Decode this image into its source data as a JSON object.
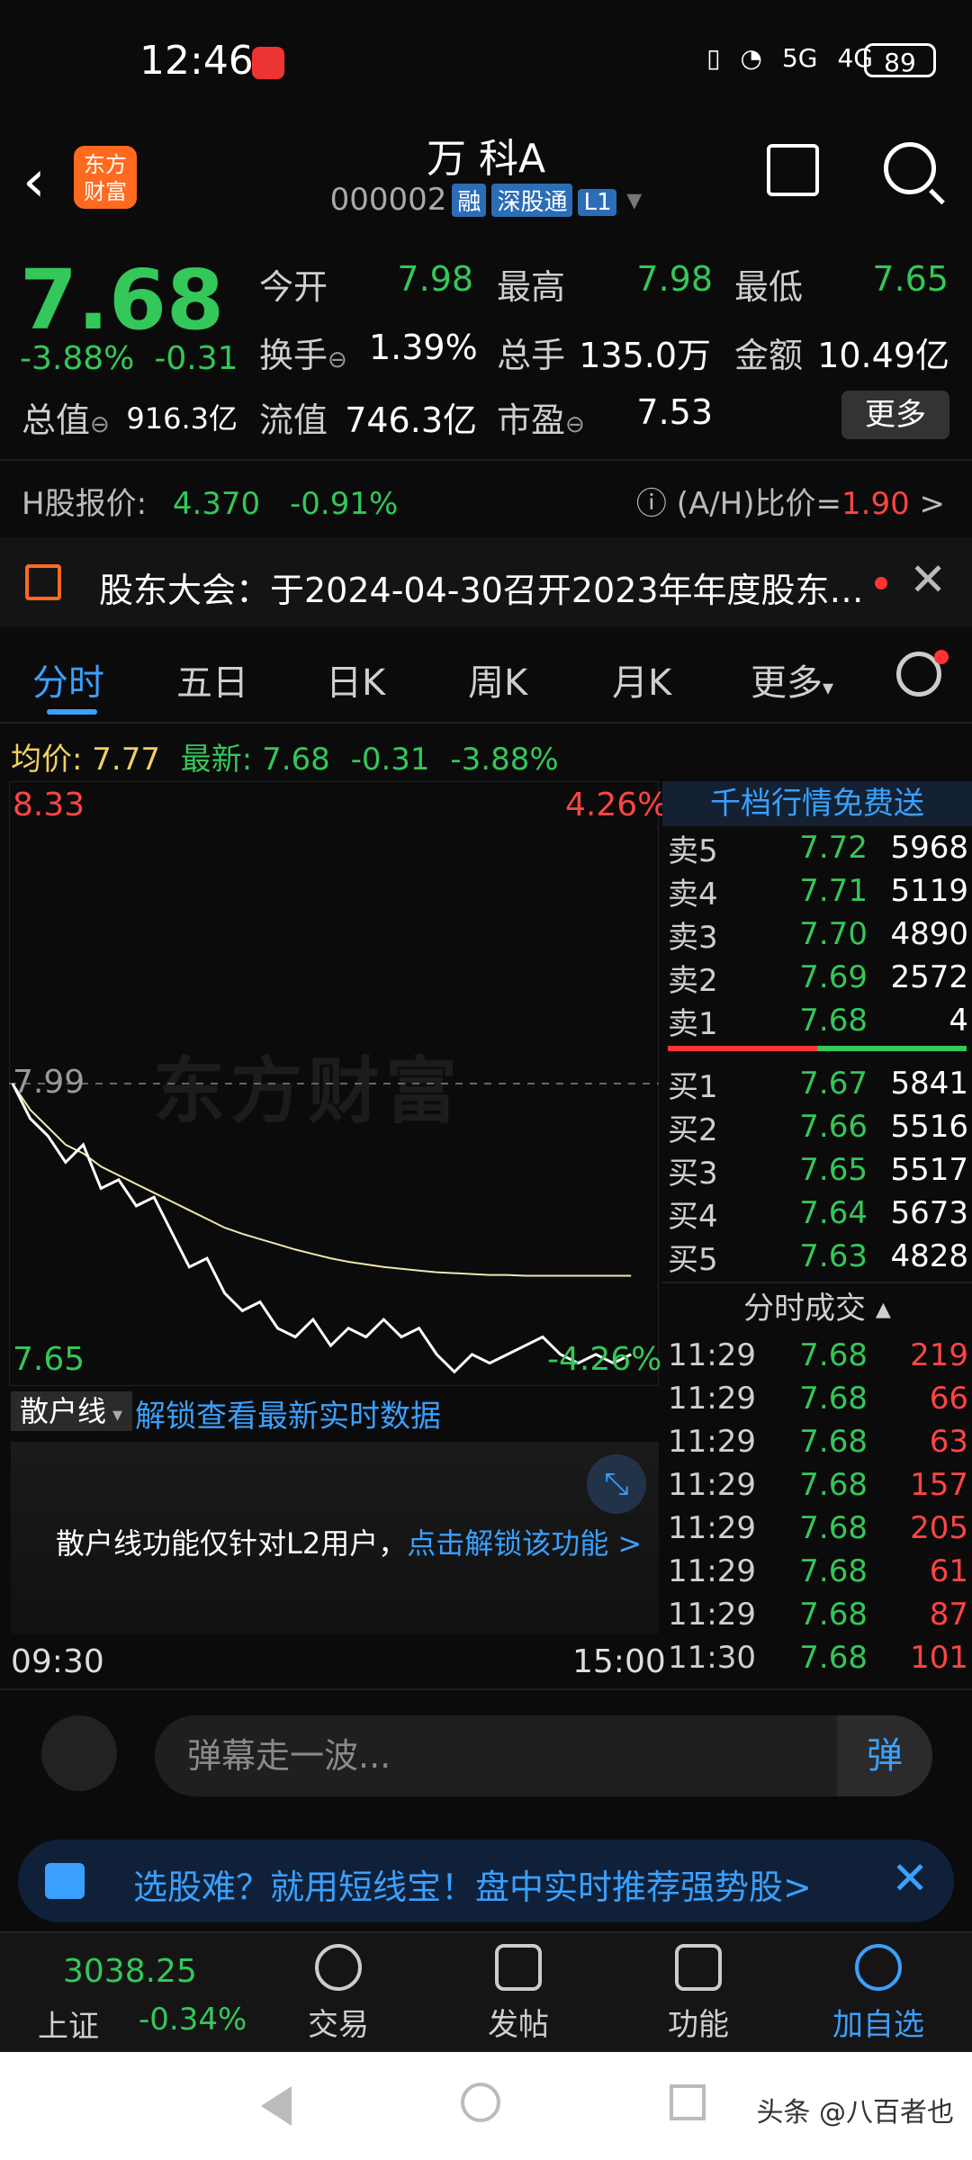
{
  "status": {
    "time": "12:46",
    "network": "5G",
    "network2": "4G",
    "battery": "89"
  },
  "header": {
    "name": "万 科A",
    "code": "000002",
    "tags": [
      "融",
      "深股通",
      "L1"
    ],
    "logo": "东方\n财富"
  },
  "quote": {
    "price": "7.68",
    "pct": "-3.88%",
    "chg": "-0.31",
    "open_lbl": "今开",
    "open": "7.98",
    "high_lbl": "最高",
    "high": "7.98",
    "low_lbl": "最低",
    "low": "7.65",
    "turnover_lbl": "换手",
    "turnover": "1.39%",
    "vol_lbl": "总手",
    "vol": "135.0万",
    "amt_lbl": "金额",
    "amt": "10.49亿",
    "mcap_lbl": "总值",
    "mcap": "916.3亿",
    "float_lbl": "流值",
    "float": "746.3亿",
    "pe_lbl": "市盈",
    "pe": "7.53",
    "more": "更多"
  },
  "hshare": {
    "label": "H股报价:",
    "price": "4.370",
    "pct": "-0.91%",
    "ah_lbl": "(A/H)比价=",
    "ah": "1.90"
  },
  "notice": {
    "text": "股东大会：于2024-04-30召开2023年年度股东…"
  },
  "tabs": [
    "分时",
    "五日",
    "日K",
    "周K",
    "月K",
    "更多"
  ],
  "avg": {
    "lbl": "均价:",
    "val": "7.77",
    "new_lbl": "最新:",
    "new": "7.68",
    "chg": "-0.31",
    "pct": "-3.88%"
  },
  "chart_data": {
    "type": "line",
    "title": "",
    "y_max": "8.33",
    "y_mid": "7.99",
    "y_min": "7.65",
    "pct_max": "4.26%",
    "pct_min": "-4.26%",
    "x_start": "09:30",
    "x_end": "15:00",
    "ylim": [
      7.65,
      8.33
    ],
    "series": [
      {
        "values": [
          7.99,
          7.95,
          7.93,
          7.9,
          7.92,
          7.87,
          7.88,
          7.85,
          7.86,
          7.82,
          7.78,
          7.79,
          7.75,
          7.73,
          7.74,
          7.71,
          7.7,
          7.72,
          7.69,
          7.71,
          7.7,
          7.72,
          7.7,
          7.71,
          7.68,
          7.66,
          7.68,
          7.67,
          7.68,
          7.69,
          7.7,
          7.68,
          7.67,
          7.68,
          7.67,
          7.68
        ]
      },
      {
        "values": [
          7.99,
          7.96,
          7.94,
          7.92,
          7.91,
          7.895,
          7.885,
          7.875,
          7.865,
          7.855,
          7.845,
          7.835,
          7.825,
          7.818,
          7.812,
          7.806,
          7.8,
          7.795,
          7.79,
          7.786,
          7.783,
          7.78,
          7.778,
          7.776,
          7.774,
          7.773,
          7.772,
          7.771,
          7.771,
          7.77,
          7.77,
          7.77,
          7.77,
          7.77,
          7.77,
          7.77
        ]
      }
    ]
  },
  "watermark": "东方财富",
  "sanhu": {
    "tag": "散户线",
    "link": "解锁查看最新实时数据",
    "msg": "散户线功能仅针对L2用户，",
    "unlock": "点击解锁该功能 >"
  },
  "orderbook": {
    "head": "千档行情免费送",
    "sells": [
      [
        "卖5",
        "7.72",
        "5968"
      ],
      [
        "卖4",
        "7.71",
        "5119"
      ],
      [
        "卖3",
        "7.70",
        "4890"
      ],
      [
        "卖2",
        "7.69",
        "2572"
      ],
      [
        "卖1",
        "7.68",
        "4"
      ]
    ],
    "buys": [
      [
        "买1",
        "7.67",
        "5841"
      ],
      [
        "买2",
        "7.66",
        "5516"
      ],
      [
        "买3",
        "7.65",
        "5517"
      ],
      [
        "买4",
        "7.64",
        "5673"
      ],
      [
        "买5",
        "7.63",
        "4828"
      ]
    ],
    "ticks_head": "分时成交 ▴",
    "ticks": [
      [
        "11:29",
        "7.68",
        "219"
      ],
      [
        "11:29",
        "7.68",
        "66"
      ],
      [
        "11:29",
        "7.68",
        "63"
      ],
      [
        "11:29",
        "7.68",
        "157"
      ],
      [
        "11:29",
        "7.68",
        "205"
      ],
      [
        "11:29",
        "7.68",
        "61"
      ],
      [
        "11:29",
        "7.68",
        "87"
      ],
      [
        "11:30",
        "7.68",
        "101"
      ]
    ]
  },
  "danmaku": {
    "placeholder": "弹幕走一波...",
    "btn": "弹"
  },
  "promo": {
    "text": "选股难？就用短线宝！盘中实时推荐强势股>"
  },
  "nav": {
    "index_val": "3038.25",
    "index_name": "上证",
    "index_chg": "-0.34%",
    "items": [
      "交易",
      "发帖",
      "功能",
      "加自选"
    ]
  },
  "footer": {
    "watermark": "头条 @八百者也"
  },
  "colors": {
    "up": "#ff4444",
    "down": "#34c759",
    "accent": "#3aa0ff"
  }
}
